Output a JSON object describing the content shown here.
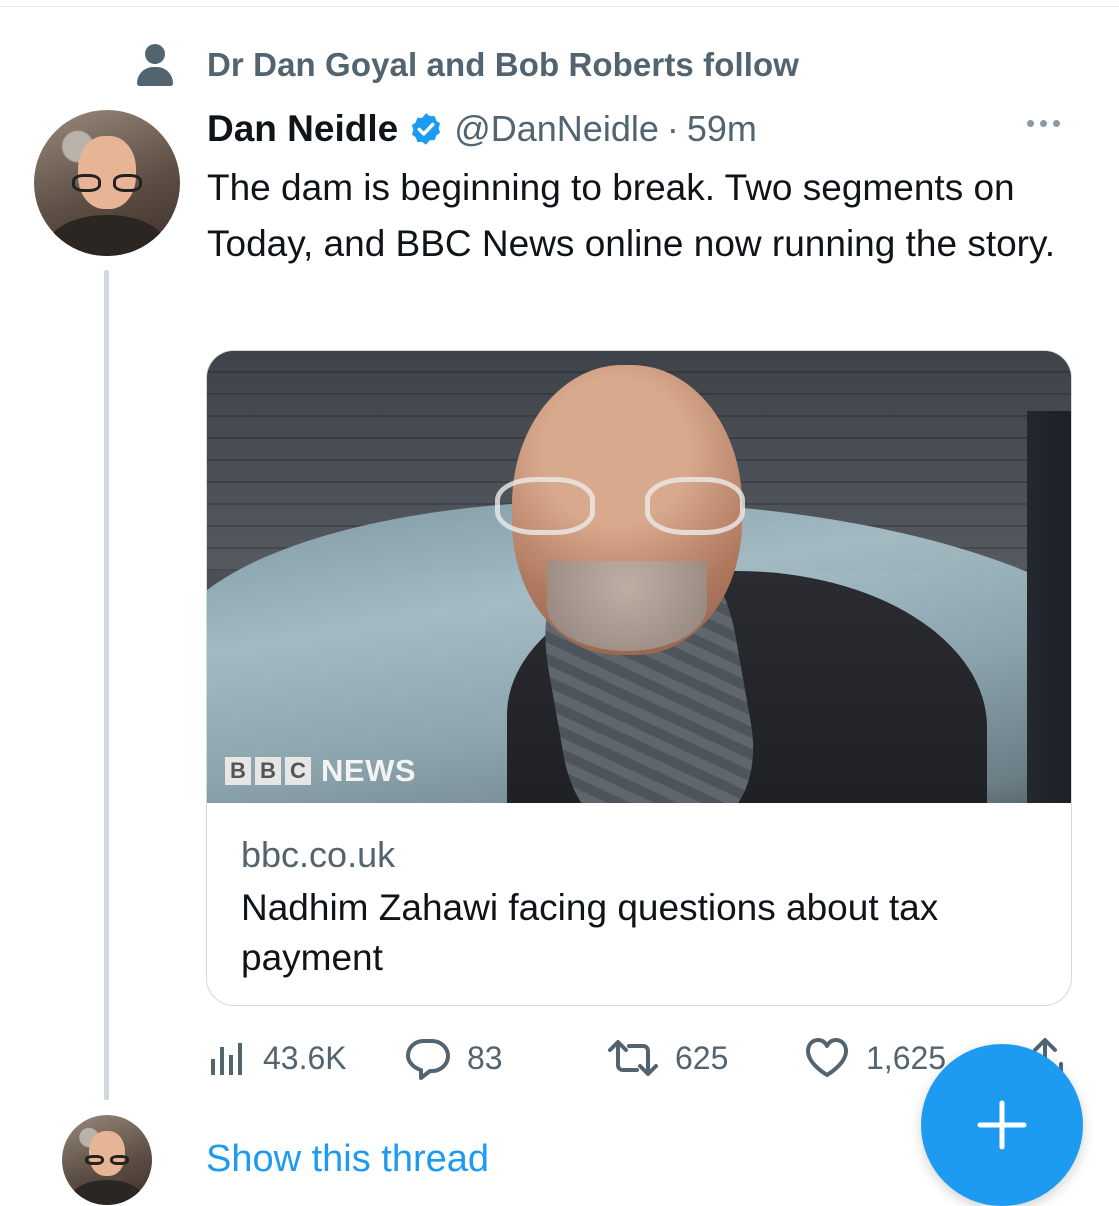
{
  "social_context": {
    "text": "Dr Dan Goyal and Bob Roberts follow",
    "icon": "person-icon"
  },
  "tweet": {
    "author_name": "Dan Neidle",
    "handle": "@DanNeidle",
    "separator": "·",
    "time": "59m",
    "verified": true,
    "text": "The dam is beginning to break. Two segments on Today, and BBC News online now running the story.",
    "card": {
      "logo_letters": [
        "B",
        "B",
        "C"
      ],
      "logo_word": "NEWS",
      "domain": "bbc.co.uk",
      "title": "Nadhim Zahawi facing questions about tax payment"
    },
    "stats": {
      "views": "43.6K",
      "replies": "83",
      "retweets": "625",
      "likes": "1,625"
    }
  },
  "thread": {
    "show_label": "Show this thread"
  },
  "colors": {
    "accent": "#1d9bf0",
    "secondary_text": "#536471",
    "primary_text": "#0f1419",
    "border": "#cfd9de"
  },
  "fab": {
    "icon": "plus-icon"
  }
}
